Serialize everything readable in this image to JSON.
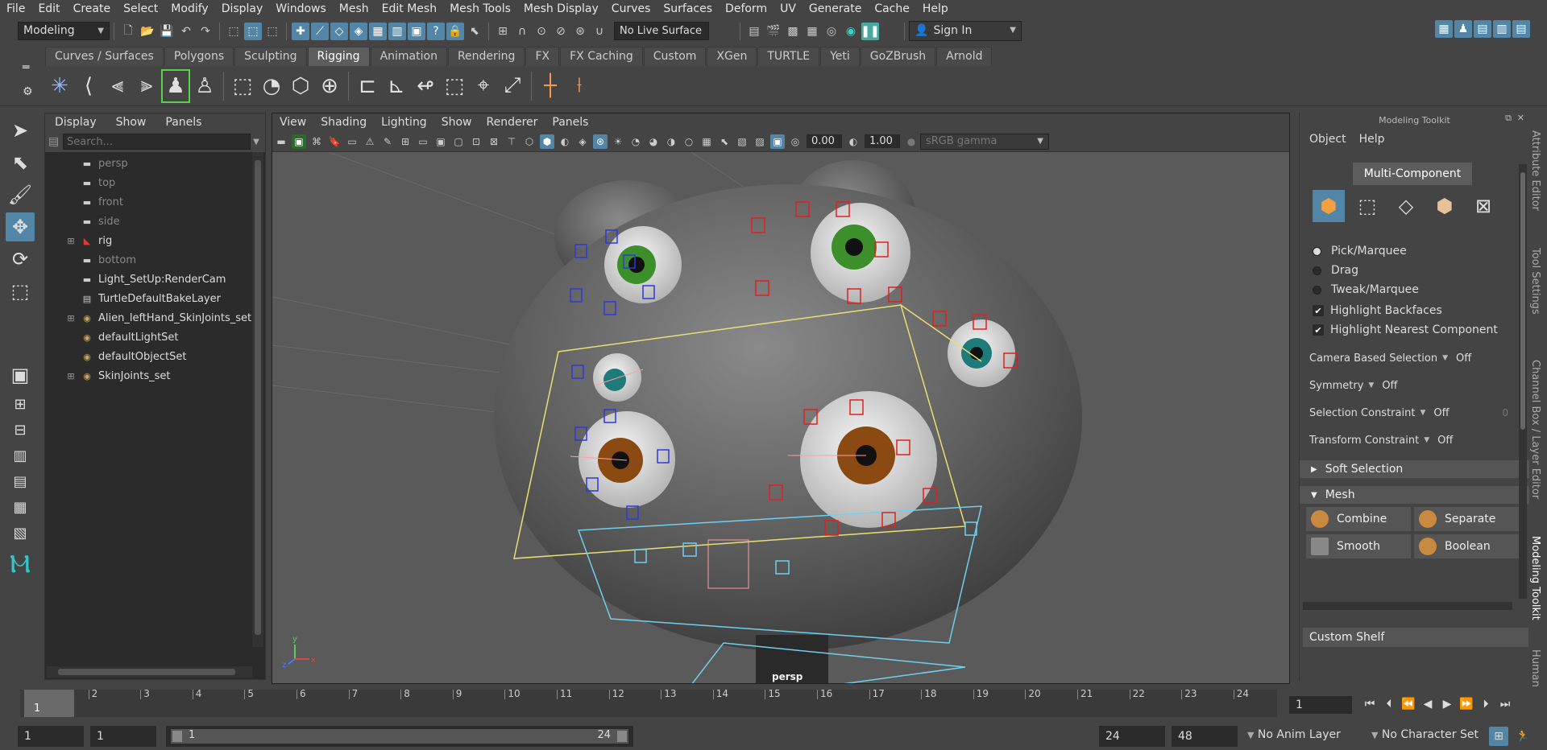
{
  "menubar": {
    "items": [
      "File",
      "Edit",
      "Create",
      "Select",
      "Modify",
      "Display",
      "Windows",
      "Mesh",
      "Edit Mesh",
      "Mesh Tools",
      "Mesh Display",
      "Curves",
      "Surfaces",
      "Deform",
      "UV",
      "Generate",
      "Cache",
      "Help"
    ]
  },
  "statusline": {
    "menuset": "Modeling",
    "live_surface": "No Live Surface",
    "sign_in": "Sign In"
  },
  "shelf": {
    "tabs": [
      "Curves / Surfaces",
      "Polygons",
      "Sculpting",
      "Rigging",
      "Animation",
      "Rendering",
      "FX",
      "FX Caching",
      "Custom",
      "XGen",
      "TURTLE",
      "Yeti",
      "GoZBrush",
      "Arnold"
    ],
    "active_tab": "Rigging"
  },
  "outliner": {
    "menu": [
      "Display",
      "Show",
      "Panels"
    ],
    "search_placeholder": "Search...",
    "items": [
      {
        "label": "persp",
        "dim": true,
        "expandable": false,
        "icon": "camera"
      },
      {
        "label": "top",
        "dim": true,
        "expandable": false,
        "icon": "camera"
      },
      {
        "label": "front",
        "dim": true,
        "expandable": false,
        "icon": "camera"
      },
      {
        "label": "side",
        "dim": true,
        "expandable": false,
        "icon": "camera"
      },
      {
        "label": "rig",
        "dim": false,
        "expandable": true,
        "icon": "joint"
      },
      {
        "label": "bottom",
        "dim": true,
        "expandable": false,
        "icon": "camera"
      },
      {
        "label": "Light_SetUp:RenderCam",
        "dim": false,
        "expandable": false,
        "icon": "camera"
      },
      {
        "label": "TurtleDefaultBakeLayer",
        "dim": false,
        "expandable": false,
        "icon": "layer"
      },
      {
        "label": "Alien_leftHand_SkinJoints_set",
        "dim": false,
        "expandable": true,
        "icon": "set"
      },
      {
        "label": "defaultLightSet",
        "dim": false,
        "expandable": false,
        "icon": "set"
      },
      {
        "label": "defaultObjectSet",
        "dim": false,
        "expandable": false,
        "icon": "set"
      },
      {
        "label": "SkinJoints_set",
        "dim": false,
        "expandable": true,
        "icon": "set"
      }
    ]
  },
  "viewport": {
    "menu": [
      "View",
      "Shading",
      "Lighting",
      "Show",
      "Renderer",
      "Panels"
    ],
    "near_value": "0.00",
    "gamma_value": "1.00",
    "colorspace": "sRGB gamma",
    "camera_label": "persp",
    "axis": {
      "x": "x",
      "y": "y",
      "z": "z"
    }
  },
  "modeling_toolkit": {
    "title": "Modeling Toolkit",
    "menu": [
      "Object",
      "Help"
    ],
    "multi_component": "Multi-Component",
    "selection_modes": [
      {
        "label": "Pick/Marquee",
        "selected": true
      },
      {
        "label": "Drag",
        "selected": false
      },
      {
        "label": "Tweak/Marquee",
        "selected": false
      }
    ],
    "checkboxes": [
      {
        "label": "Highlight Backfaces",
        "checked": true
      },
      {
        "label": "Highlight Nearest Component",
        "checked": true
      }
    ],
    "options": [
      {
        "label": "Camera Based Selection",
        "value": "Off"
      },
      {
        "label": "Symmetry",
        "value": "Off"
      },
      {
        "label": "Selection Constraint",
        "value": "Off",
        "extra": "0"
      },
      {
        "label": "Transform Constraint",
        "value": "Off"
      }
    ],
    "soft_selection": "Soft Selection",
    "mesh_section": "Mesh",
    "mesh_buttons": [
      "Combine",
      "Separate",
      "Smooth",
      "Boolean"
    ],
    "custom_shelf": "Custom Shelf"
  },
  "side_tabs": [
    "Attribute Editor",
    "Tool Settings",
    "Channel Box / Layer Editor",
    "Modeling Toolkit",
    "Human IK"
  ],
  "timeline": {
    "ticks": [
      "1",
      "2",
      "3",
      "4",
      "5",
      "6",
      "7",
      "8",
      "9",
      "10",
      "11",
      "12",
      "13",
      "14",
      "15",
      "16",
      "17",
      "18",
      "19",
      "20",
      "21",
      "22",
      "23",
      "24"
    ],
    "current_frame_marker": "1",
    "current_frame": "1"
  },
  "range": {
    "start": "1",
    "start2": "1",
    "slider_start": "1",
    "slider_end": "24",
    "end": "24",
    "end2": "48",
    "anim_layer": "No Anim Layer",
    "character_set": "No Character Set"
  }
}
